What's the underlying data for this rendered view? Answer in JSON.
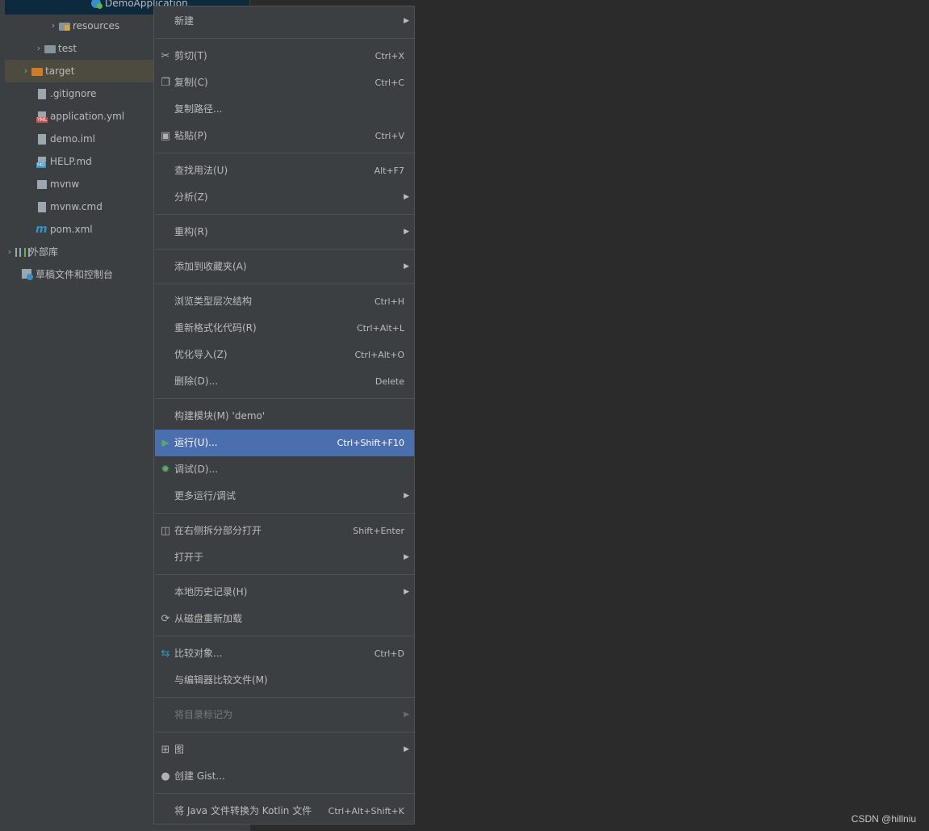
{
  "tree": {
    "items": [
      {
        "label": "DemoApplication"
      },
      {
        "label": "resources"
      },
      {
        "label": "test"
      },
      {
        "label": "target"
      },
      {
        "label": ".gitignore"
      },
      {
        "label": "application.yml"
      },
      {
        "label": "demo.iml"
      },
      {
        "label": "HELP.md"
      },
      {
        "label": "mvnw"
      },
      {
        "label": "mvnw.cmd"
      },
      {
        "label": "pom.xml"
      },
      {
        "label": "外部库"
      },
      {
        "label": "草稿文件和控制台"
      }
    ],
    "icon_tags": {
      "yml": "YML",
      "md": "MD",
      "maven": "m"
    }
  },
  "menu": {
    "items": [
      {
        "label": "新建",
        "shortcut": "",
        "submenu": true
      },
      {
        "label": "剪切(T)",
        "shortcut": "Ctrl+X",
        "icon": "scissors-icon"
      },
      {
        "label": "复制(C)",
        "shortcut": "Ctrl+C",
        "icon": "copy-icon"
      },
      {
        "label": "复制路径...",
        "shortcut": ""
      },
      {
        "label": "粘贴(P)",
        "shortcut": "Ctrl+V",
        "icon": "paste-icon"
      },
      {
        "label": "查找用法(U)",
        "shortcut": "Alt+F7"
      },
      {
        "label": "分析(Z)",
        "shortcut": "",
        "submenu": true
      },
      {
        "label": "重构(R)",
        "shortcut": "",
        "submenu": true
      },
      {
        "label": "添加到收藏夹(A)",
        "shortcut": "",
        "submenu": true
      },
      {
        "label": "浏览类型层次结构",
        "shortcut": "Ctrl+H"
      },
      {
        "label": "重新格式化代码(R)",
        "shortcut": "Ctrl+Alt+L"
      },
      {
        "label": "优化导入(Z)",
        "shortcut": "Ctrl+Alt+O"
      },
      {
        "label": "删除(D)...",
        "shortcut": "Delete"
      },
      {
        "label": "构建模块(M) 'demo'",
        "shortcut": ""
      },
      {
        "label": "运行(U)...",
        "shortcut": "Ctrl+Shift+F10",
        "icon": "run-icon",
        "highlighted": true
      },
      {
        "label": "调试(D)...",
        "shortcut": "",
        "icon": "debug-icon"
      },
      {
        "label": "更多运行/调试",
        "shortcut": "",
        "submenu": true
      },
      {
        "label": "在右侧拆分部分打开",
        "shortcut": "Shift+Enter",
        "icon": "split-icon"
      },
      {
        "label": "打开于",
        "shortcut": "",
        "submenu": true
      },
      {
        "label": "本地历史记录(H)",
        "shortcut": "",
        "submenu": true
      },
      {
        "label": "从磁盘重新加载",
        "shortcut": "",
        "icon": "reload-icon"
      },
      {
        "label": "比较对象...",
        "shortcut": "Ctrl+D",
        "icon": "compare-icon"
      },
      {
        "label": "与编辑器比较文件(M)",
        "shortcut": ""
      },
      {
        "label": "将目录标记为",
        "shortcut": "",
        "submenu": true,
        "disabled": true
      },
      {
        "label": "图",
        "shortcut": "",
        "submenu": true,
        "icon": "diagram-icon"
      },
      {
        "label": "创建 Gist...",
        "shortcut": "",
        "icon": "github-icon"
      },
      {
        "label": "将 Java 文件转换为 Kotlin 文件",
        "shortcut": "Ctrl+Alt+Shift+K"
      }
    ],
    "highlight_color": "#4b6eaf"
  },
  "watermark": "CSDN @hillniu"
}
